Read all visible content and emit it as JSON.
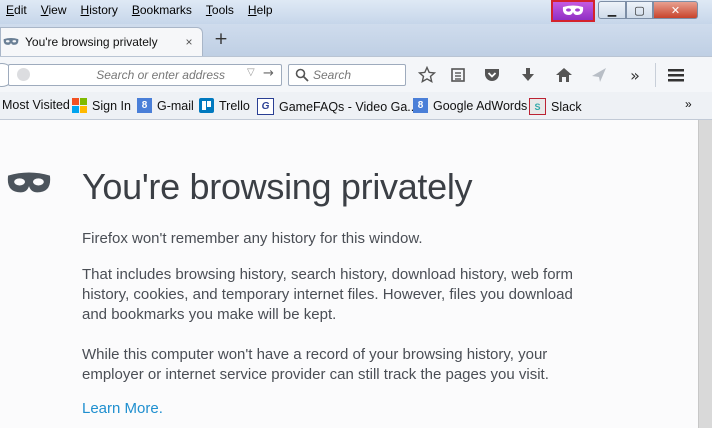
{
  "menu": [
    "Edit",
    "View",
    "History",
    "Bookmarks",
    "Tools",
    "Help"
  ],
  "window_controls": {
    "minimize": "▁",
    "maximize": "▢",
    "close": "✕"
  },
  "tab": {
    "title": "You're browsing privately",
    "close": "×",
    "icon": "private-mask-icon"
  },
  "new_tab_label": "+",
  "navbar": {
    "url_placeholder": "Search or enter address",
    "search_placeholder": "Search",
    "overflow": "»"
  },
  "bookmarks": [
    {
      "label": "Most Visited",
      "icon": "none"
    },
    {
      "label": "Sign In",
      "icon": "windows-logo-icon"
    },
    {
      "label": "G-mail",
      "icon": "google-g-icon",
      "glyph": "8"
    },
    {
      "label": "Trello",
      "icon": "trello-icon"
    },
    {
      "label": "GameFAQs - Video Ga...",
      "icon": "gamefaqs-icon",
      "glyph": "G"
    },
    {
      "label": "Google AdWords",
      "icon": "google-g-icon",
      "glyph": "8"
    },
    {
      "label": "Slack",
      "icon": "slack-icon",
      "glyph": "S"
    }
  ],
  "bookmarks_overflow": "»",
  "page": {
    "title": "You're browsing privately",
    "p1": "Firefox won't remember any history for this window.",
    "p2": "That includes browsing history, search history, download history, web form history, cookies, and temporary internet files. However, files you download and bookmarks you make will be kept.",
    "p3": "While this computer won't have a record of your browsing history, your employer or internet service provider can still track the pages you visit.",
    "learn_more": "Learn More."
  },
  "colors": {
    "private_badge": "#a240d2",
    "badge_border": "#d4232c",
    "link": "#1f8fcf",
    "title_text": "#3b3f45"
  }
}
